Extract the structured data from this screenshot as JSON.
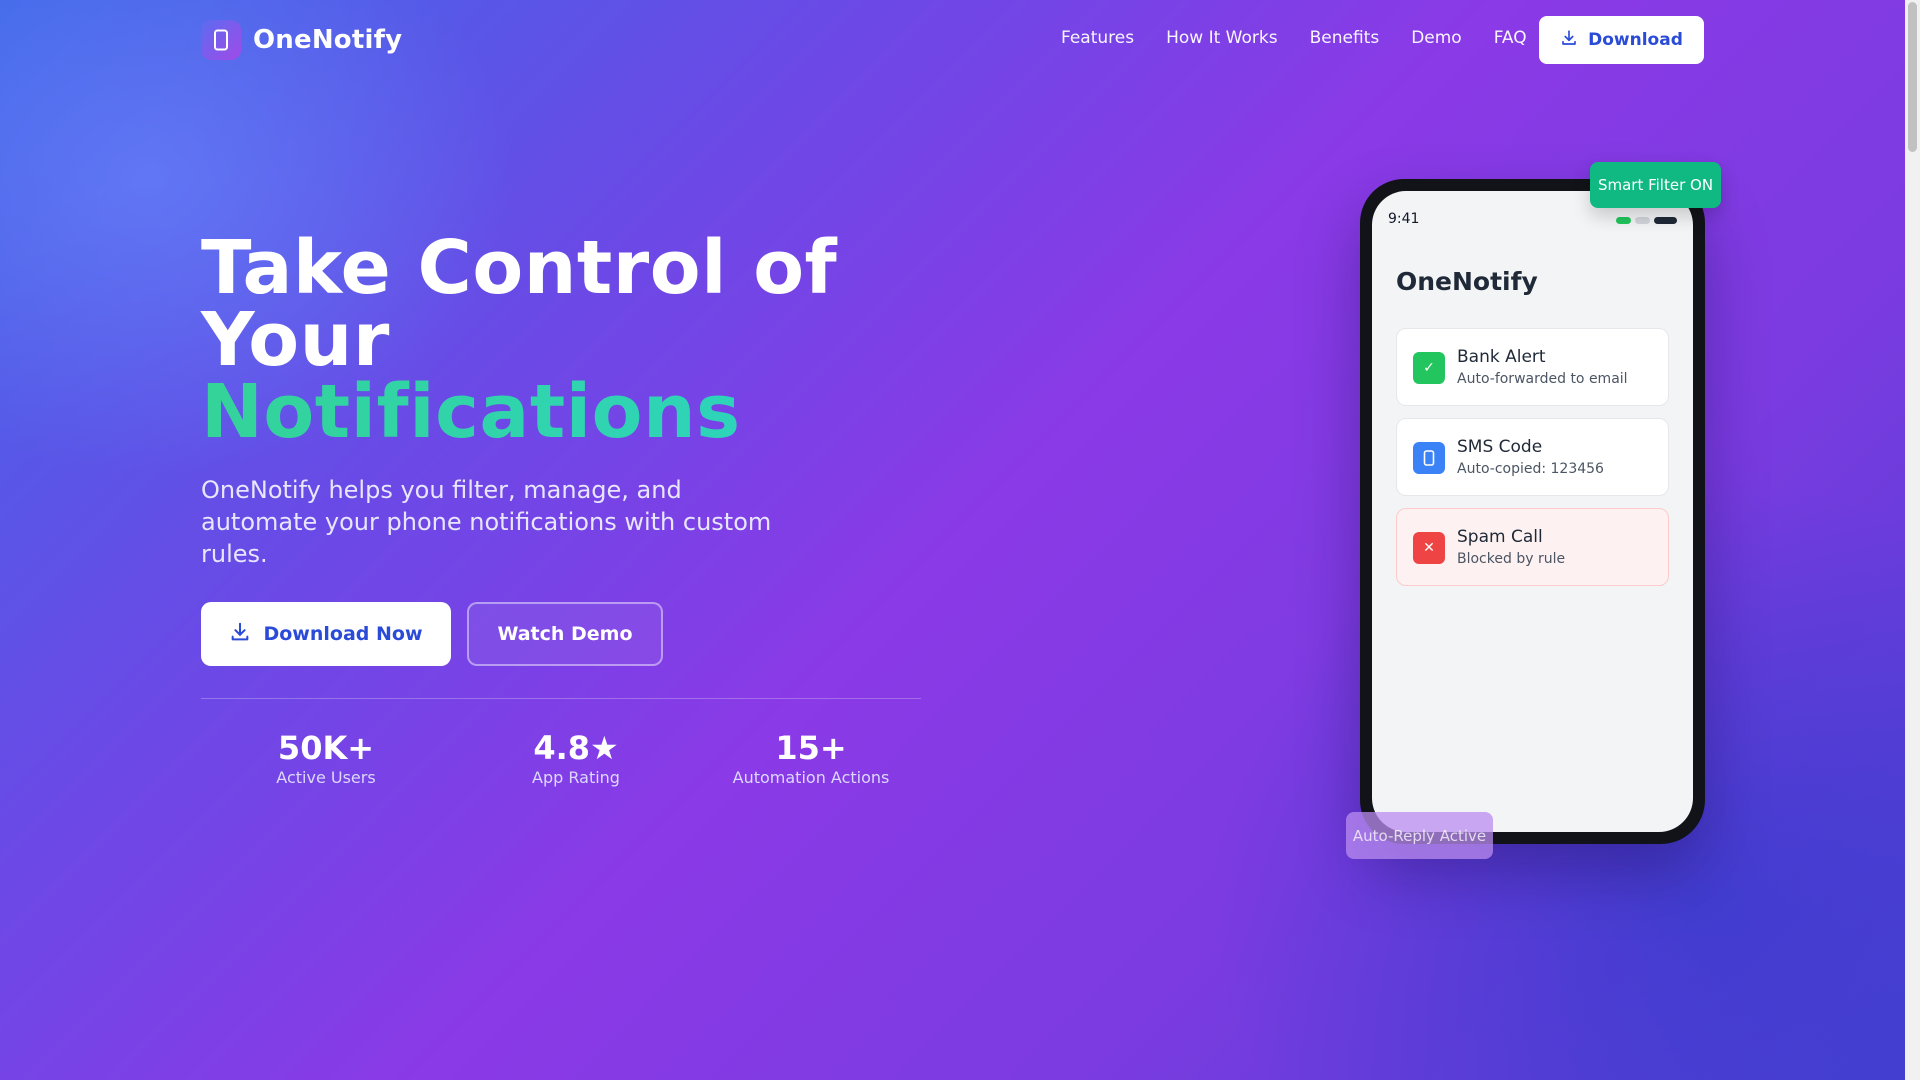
{
  "brand": {
    "name": "OneNotify",
    "logo_icon": "phone-icon"
  },
  "nav": {
    "links": [
      "Features",
      "How It Works",
      "Benefits",
      "Demo",
      "FAQ"
    ],
    "download_label": "Download"
  },
  "hero": {
    "title_line1": "Take Control of",
    "title_line2": "Your",
    "title_accent": "Notifications",
    "subtitle": "OneNotify helps you filter, manage, and automate your phone notifications with custom rules.",
    "primary_cta": "Download Now",
    "secondary_cta": "Watch Demo"
  },
  "stats": [
    {
      "value": "50K+",
      "label": "Active Users"
    },
    {
      "value": "4.8★",
      "label": "App Rating"
    },
    {
      "value": "15+",
      "label": "Automation Actions"
    }
  ],
  "phone": {
    "time": "9:41",
    "app_title": "OneNotify",
    "cards": [
      {
        "title": "Bank Alert",
        "subtitle": "Auto-forwarded to email",
        "icon": "✓",
        "icon_name": "check-icon",
        "color": "#22c55e"
      },
      {
        "title": "SMS Code",
        "subtitle": "Auto-copied: 123456",
        "icon_name": "phone-icon",
        "color": "#3b82f6"
      },
      {
        "title": "Spam Call",
        "subtitle": "Blocked by rule",
        "icon": "✕",
        "icon_name": "close-icon",
        "color": "#ef4444"
      }
    ]
  },
  "badges": {
    "filter": "Smart Filter ON",
    "reply": "Auto-Reply Active"
  },
  "colors": {
    "accent_green": "#34d399",
    "primary_blue": "#2a4ad8",
    "badge_green": "#10b981"
  }
}
